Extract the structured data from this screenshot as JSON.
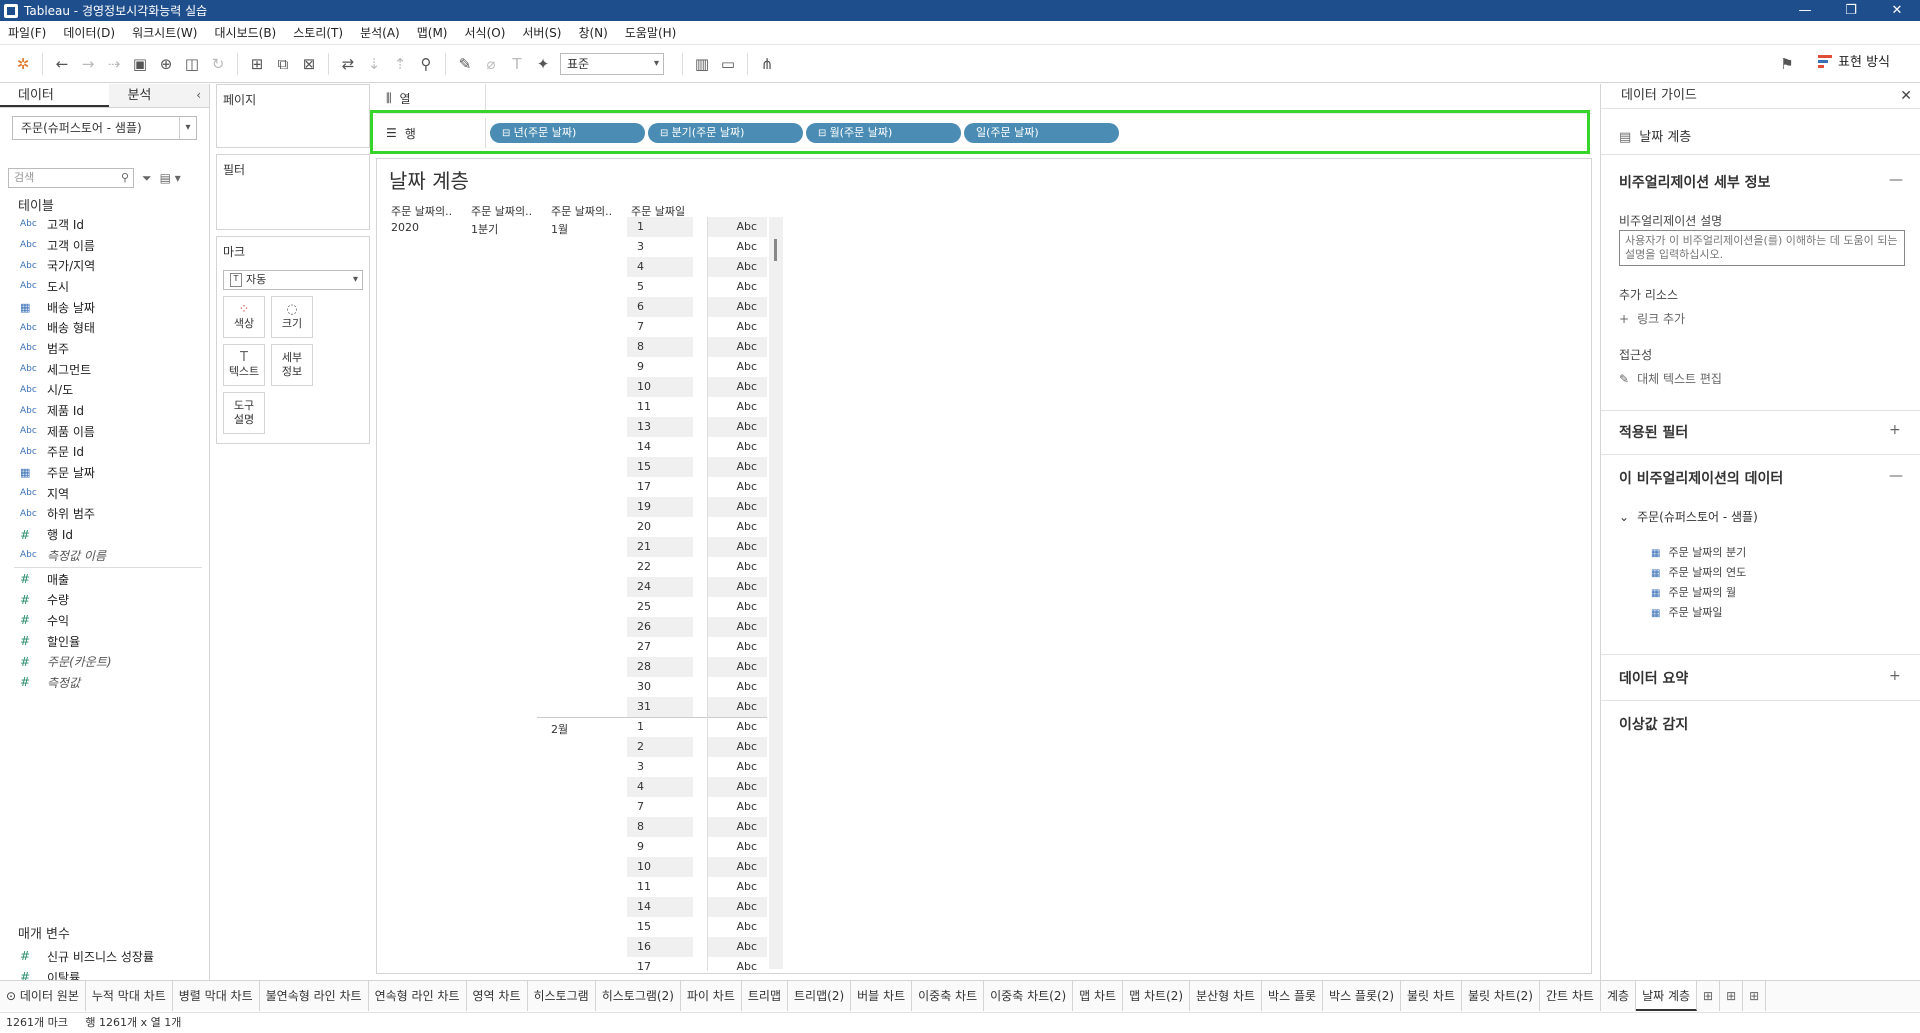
{
  "window": {
    "title": "Tableau - 경영정보시각화능력 실습",
    "controls": [
      "—",
      "❐",
      "✕"
    ]
  },
  "menu": [
    "파일(F)",
    "데이터(D)",
    "워크시트(W)",
    "대시보드(B)",
    "스토리(T)",
    "분석(A)",
    "맵(M)",
    "서식(O)",
    "서버(S)",
    "창(N)",
    "도움말(H)"
  ],
  "toolbar": {
    "fit_value": "표준",
    "show_me_label": "표현 방식"
  },
  "data_pane": {
    "tab_data": "데이터",
    "tab_analysis": "분석",
    "datasource": "주문(슈퍼스토어 - 샘플)",
    "search_placeholder": "검색",
    "tables_label": "테이블",
    "dimensions": [
      {
        "icon": "Abc",
        "name": "고객 Id"
      },
      {
        "icon": "Abc",
        "name": "고객 이름"
      },
      {
        "icon": "Abc",
        "name": "국가/지역"
      },
      {
        "icon": "Abc",
        "name": "도시"
      },
      {
        "icon": "date",
        "name": "배송 날짜"
      },
      {
        "icon": "Abc",
        "name": "배송 형태"
      },
      {
        "icon": "Abc",
        "name": "범주"
      },
      {
        "icon": "Abc",
        "name": "세그먼트"
      },
      {
        "icon": "Abc",
        "name": "시/도"
      },
      {
        "icon": "Abc",
        "name": "제품 Id"
      },
      {
        "icon": "Abc",
        "name": "제품 이름"
      },
      {
        "icon": "Abc",
        "name": "주문 Id"
      },
      {
        "icon": "date",
        "name": "주문 날짜"
      },
      {
        "icon": "Abc",
        "name": "지역"
      },
      {
        "icon": "Abc",
        "name": "하위 범주"
      },
      {
        "icon": "#",
        "name": "행 Id"
      },
      {
        "icon": "Abc",
        "name": "측정값 이름",
        "italic": true
      }
    ],
    "measures": [
      {
        "icon": "#",
        "name": "매출"
      },
      {
        "icon": "#",
        "name": "수량"
      },
      {
        "icon": "#",
        "name": "수익"
      },
      {
        "icon": "#",
        "name": "할인율"
      },
      {
        "icon": "#",
        "name": "주문(카운트)",
        "italic": true
      },
      {
        "icon": "#",
        "name": "측정값",
        "italic": true
      }
    ],
    "params_label": "매개 변수",
    "params": [
      {
        "icon": "#",
        "name": "신규 비즈니스 성장률"
      },
      {
        "icon": "#",
        "name": "이탈률"
      }
    ]
  },
  "cards": {
    "pages": "페이지",
    "filters": "필터",
    "marks": "마크",
    "mark_type": "자동",
    "mark_buttons": [
      {
        "icon": "color-icon",
        "glyph": "⁘",
        "label": "색상"
      },
      {
        "icon": "size-icon",
        "glyph": "◌",
        "label": "크기"
      },
      {
        "icon": "text-icon",
        "glyph": "T",
        "label": "텍스트"
      },
      {
        "icon": "detail-icon",
        "glyph": "",
        "label": "세부\n정보"
      },
      {
        "icon": "tooltip-icon",
        "glyph": "",
        "label": "도구\n설명"
      }
    ]
  },
  "shelves": {
    "columns_label": "열",
    "rows_label": "행",
    "row_pills": [
      "년(주문 날짜)",
      "분기(주문 날짜)",
      "월(주문 날짜)",
      "일(주문 날짜)"
    ]
  },
  "view": {
    "title": "날짜 계층",
    "headers": [
      "주문 날짜의..",
      "주문 날짜의..",
      "주문 날짜의..",
      "주문 날짜일"
    ],
    "year": "2020",
    "quarter": "1분기",
    "months": [
      {
        "label": "1월",
        "days": [
          "1",
          "3",
          "4",
          "5",
          "6",
          "7",
          "8",
          "9",
          "10",
          "11",
          "13",
          "14",
          "15",
          "17",
          "19",
          "20",
          "21",
          "22",
          "24",
          "25",
          "26",
          "27",
          "28",
          "30",
          "31"
        ]
      },
      {
        "label": "2월",
        "days": [
          "1",
          "2",
          "3",
          "4",
          "7",
          "8",
          "9",
          "10",
          "11",
          "14",
          "15",
          "16",
          "17"
        ]
      }
    ],
    "cell_text": "Abc"
  },
  "guide": {
    "title": "데이터 가이드",
    "sheet_name": "날짜 계층",
    "viz_details": "비주얼리제이션 세부 정보",
    "viz_desc_label": "비주얼리제이션 설명",
    "viz_desc_placeholder": "사용자가 이 비주얼리제이션을(를) 이해하는 데 도움이 되는 설명을 입력하십시오.",
    "extra_resources": "추가 리소스",
    "add_link": "링크 추가",
    "accessibility": "접근성",
    "edit_alt": "대체 텍스트 편집",
    "applied_filters": "적용된 필터",
    "viz_data": "이 비주얼리제이션의 데이터",
    "datasource": "주문(슈퍼스토어 - 샘플)",
    "data_fields": [
      "주문 날짜의 분기",
      "주문 날짜의 연도",
      "주문 날짜의 월",
      "주문 날짜일"
    ],
    "data_summary": "데이터 요약",
    "outlier": "이상값 감지"
  },
  "sheet_tabs": [
    "데이터 원본",
    "누적 막대 차트",
    "병렬 막대 차트",
    "불연속형 라인 차트",
    "연속형 라인 차트",
    "영역 차트",
    "히스토그램",
    "히스토그램(2)",
    "파이 차트",
    "트리맵",
    "트리맵(2)",
    "버블 차트",
    "이중축 차트",
    "이중축 차트(2)",
    "맵 차트",
    "맵 차트(2)",
    "분산형 차트",
    "박스 플롯",
    "박스 플롯(2)",
    "불릿 차트",
    "불릿 차트(2)",
    "간트 차트",
    "계층",
    "날짜 계층"
  ],
  "active_tab": "날짜 계층",
  "status": {
    "marks": "1261개 마크",
    "dims": "행 1261개 x 열 1개"
  }
}
